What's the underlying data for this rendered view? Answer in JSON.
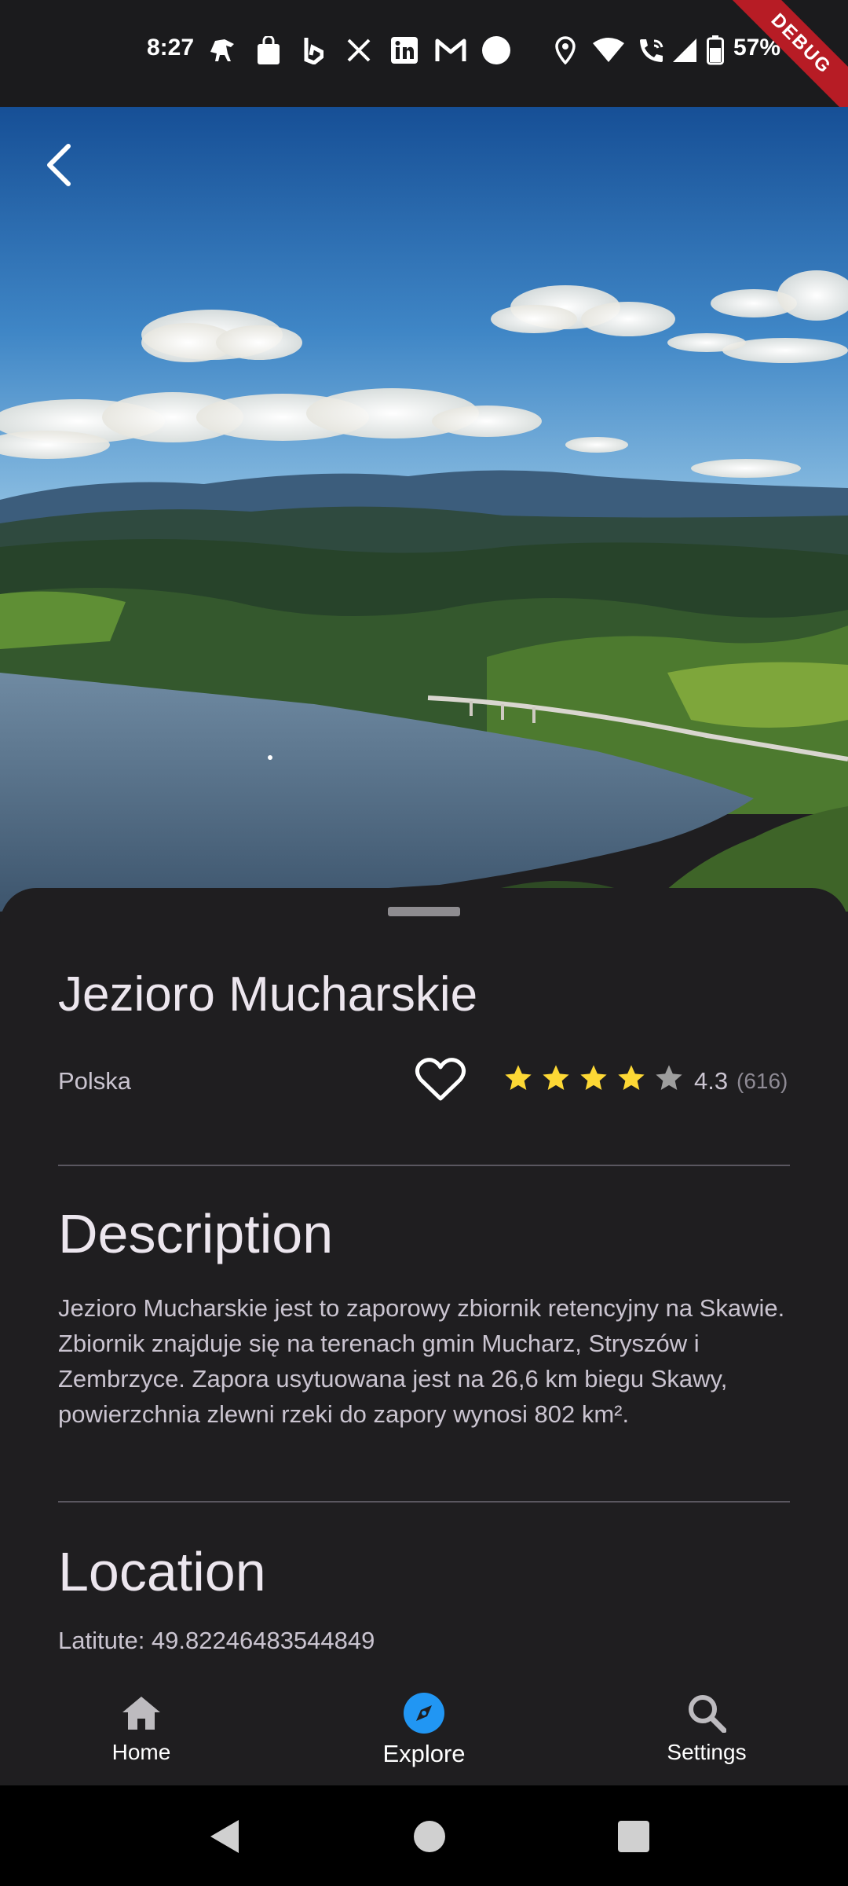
{
  "status_bar": {
    "time": "8:27",
    "battery": "57%",
    "icons": [
      "horse-app-icon",
      "shopping-bag-icon",
      "bing-icon",
      "x-icon",
      "linkedin-icon",
      "gmail-icon",
      "circle-icon",
      "location-icon",
      "wifi-icon",
      "wifi-call-icon",
      "signal-icon",
      "battery-icon"
    ]
  },
  "debug_banner": "DEBUG",
  "place": {
    "name": "Jezioro Mucharskie",
    "country": "Polska",
    "rating": 4.3,
    "rating_label": "4.3",
    "reviews": "(616)",
    "favorite": false
  },
  "description": {
    "heading": "Description",
    "text": "Jezioro Mucharskie jest to zaporowy zbiornik retencyjny na Skawie. Zbiornik znajduje się na terenach gmin Mucharz, Stryszów i Zembrzyce. Zapora usytuowana jest na 26,6 km biegu Skawy, powierzchnia zlewni rzeki do zapory wynosi 802 km²."
  },
  "location": {
    "heading": "Location",
    "latitude_text": "Latitute: 49.82246483544849"
  },
  "bottom_nav": {
    "items": [
      {
        "label": "Home",
        "icon": "home-icon",
        "active": false
      },
      {
        "label": "Explore",
        "icon": "explore-icon",
        "active": true
      },
      {
        "label": "Settings",
        "icon": "search-icon",
        "active": false
      }
    ]
  },
  "colors": {
    "background": "#1f1e20",
    "star": "#fdd835",
    "star_empty": "#9e9e9e",
    "accent": "#2196f3",
    "debug": "#b71c25"
  }
}
